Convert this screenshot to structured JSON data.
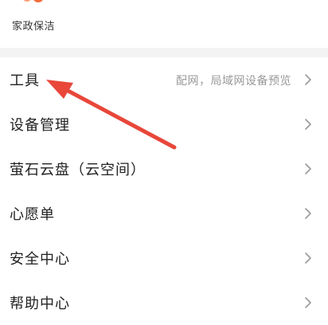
{
  "top": {
    "service_label": "家政保洁"
  },
  "menu": {
    "items": [
      {
        "label": "工具",
        "sub": "配网，局域网设备预览"
      },
      {
        "label": "设备管理",
        "sub": ""
      },
      {
        "label": "萤石云盘（云空间）",
        "sub": ""
      },
      {
        "label": "心愿单",
        "sub": ""
      },
      {
        "label": "安全中心",
        "sub": ""
      },
      {
        "label": "帮助中心",
        "sub": ""
      }
    ]
  },
  "colors": {
    "accent": "#f26b3a",
    "annotation_arrow": "#e8473a"
  },
  "icons": {
    "chevron": "chevron-right-icon",
    "annotation": "annotation-arrow"
  }
}
